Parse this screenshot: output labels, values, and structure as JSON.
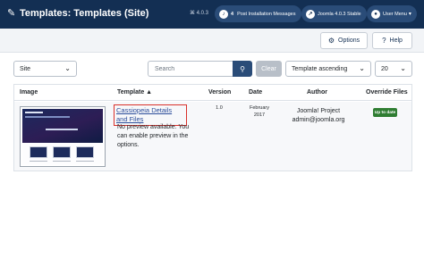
{
  "header": {
    "title": "Templates: Templates (Site)",
    "version": "⌘ 4.0.3",
    "notifications": {
      "count": "4",
      "label": "Post Installation Messages"
    },
    "joomla": "Joomla 4.0.3 Stable",
    "user_menu": "User Menu"
  },
  "toolbar": {
    "options": "Options",
    "help": "Help"
  },
  "filters": {
    "client": "Site",
    "search_placeholder": "Search",
    "clear": "Clear",
    "ordering": "Template ascending",
    "limit": "20"
  },
  "table": {
    "headers": {
      "image": "Image",
      "template": "Template ▲",
      "version": "Version",
      "date": "Date",
      "author": "Author",
      "overrides": "Override Files"
    },
    "rows": [
      {
        "name": "Cassiopeia Details and Files",
        "note": "No preview available. You can enable preview in the options.",
        "version": "1.0",
        "date": "February 2017",
        "author": "Joomla! Project",
        "email": "admin@joomla.org",
        "override_status": "Up to date"
      }
    ]
  },
  "colors": {
    "header_bg": "#132f53",
    "accent": "#2a4c78",
    "badge": "#2f7d32",
    "highlight_box": "#d9312b"
  },
  "icons": [
    "brush-icon",
    "bell-icon",
    "external-link-icon",
    "user-icon",
    "gear-icon",
    "question-icon",
    "search-icon",
    "chevron-down-icon"
  ]
}
